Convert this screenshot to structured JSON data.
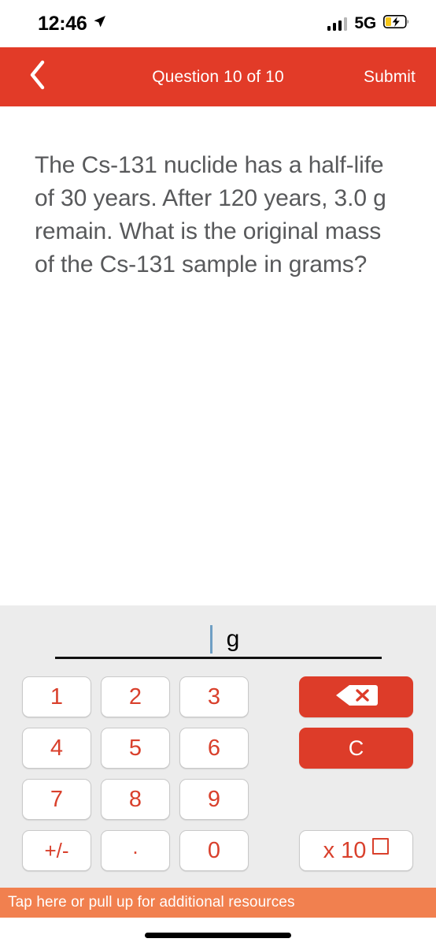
{
  "status_bar": {
    "time": "12:46",
    "location_icon": "location-arrow-icon",
    "signal_icon": "cellular-signal-icon",
    "network": "5G",
    "battery_icon": "battery-charging-icon"
  },
  "nav_bar": {
    "back_icon": "chevron-left-icon",
    "title": "Question 10 of 10",
    "submit_label": "Submit",
    "background_color": "#E23B28"
  },
  "question": {
    "text": "The Cs-131 nuclide has a half-life of 30 years. After 120 years, 3.0 g remain. What is the original mass of the Cs-131 sample in grams?"
  },
  "answer_field": {
    "value": "",
    "unit": "g",
    "caret_color": "#6f9fc4"
  },
  "keypad": {
    "keys": [
      {
        "label": "1",
        "name": "key-1"
      },
      {
        "label": "2",
        "name": "key-2"
      },
      {
        "label": "3",
        "name": "key-3"
      },
      {
        "label": "4",
        "name": "key-4"
      },
      {
        "label": "5",
        "name": "key-5"
      },
      {
        "label": "6",
        "name": "key-6"
      },
      {
        "label": "7",
        "name": "key-7"
      },
      {
        "label": "8",
        "name": "key-8"
      },
      {
        "label": "9",
        "name": "key-9"
      },
      {
        "label": "+/-",
        "name": "key-sign-toggle"
      },
      {
        "label": ".",
        "name": "key-decimal-point"
      },
      {
        "label": "0",
        "name": "key-0"
      }
    ],
    "backspace_icon": "backspace-delete-icon",
    "clear_label": "C",
    "scientific_label": "x 10",
    "key_text_color": "#d9402c",
    "action_color": "#dd3c29"
  },
  "resource_bar": {
    "text": "Tap here or pull up for additional resources",
    "background_color": "#F1804F"
  },
  "home_indicator": {
    "name": "home-indicator"
  }
}
